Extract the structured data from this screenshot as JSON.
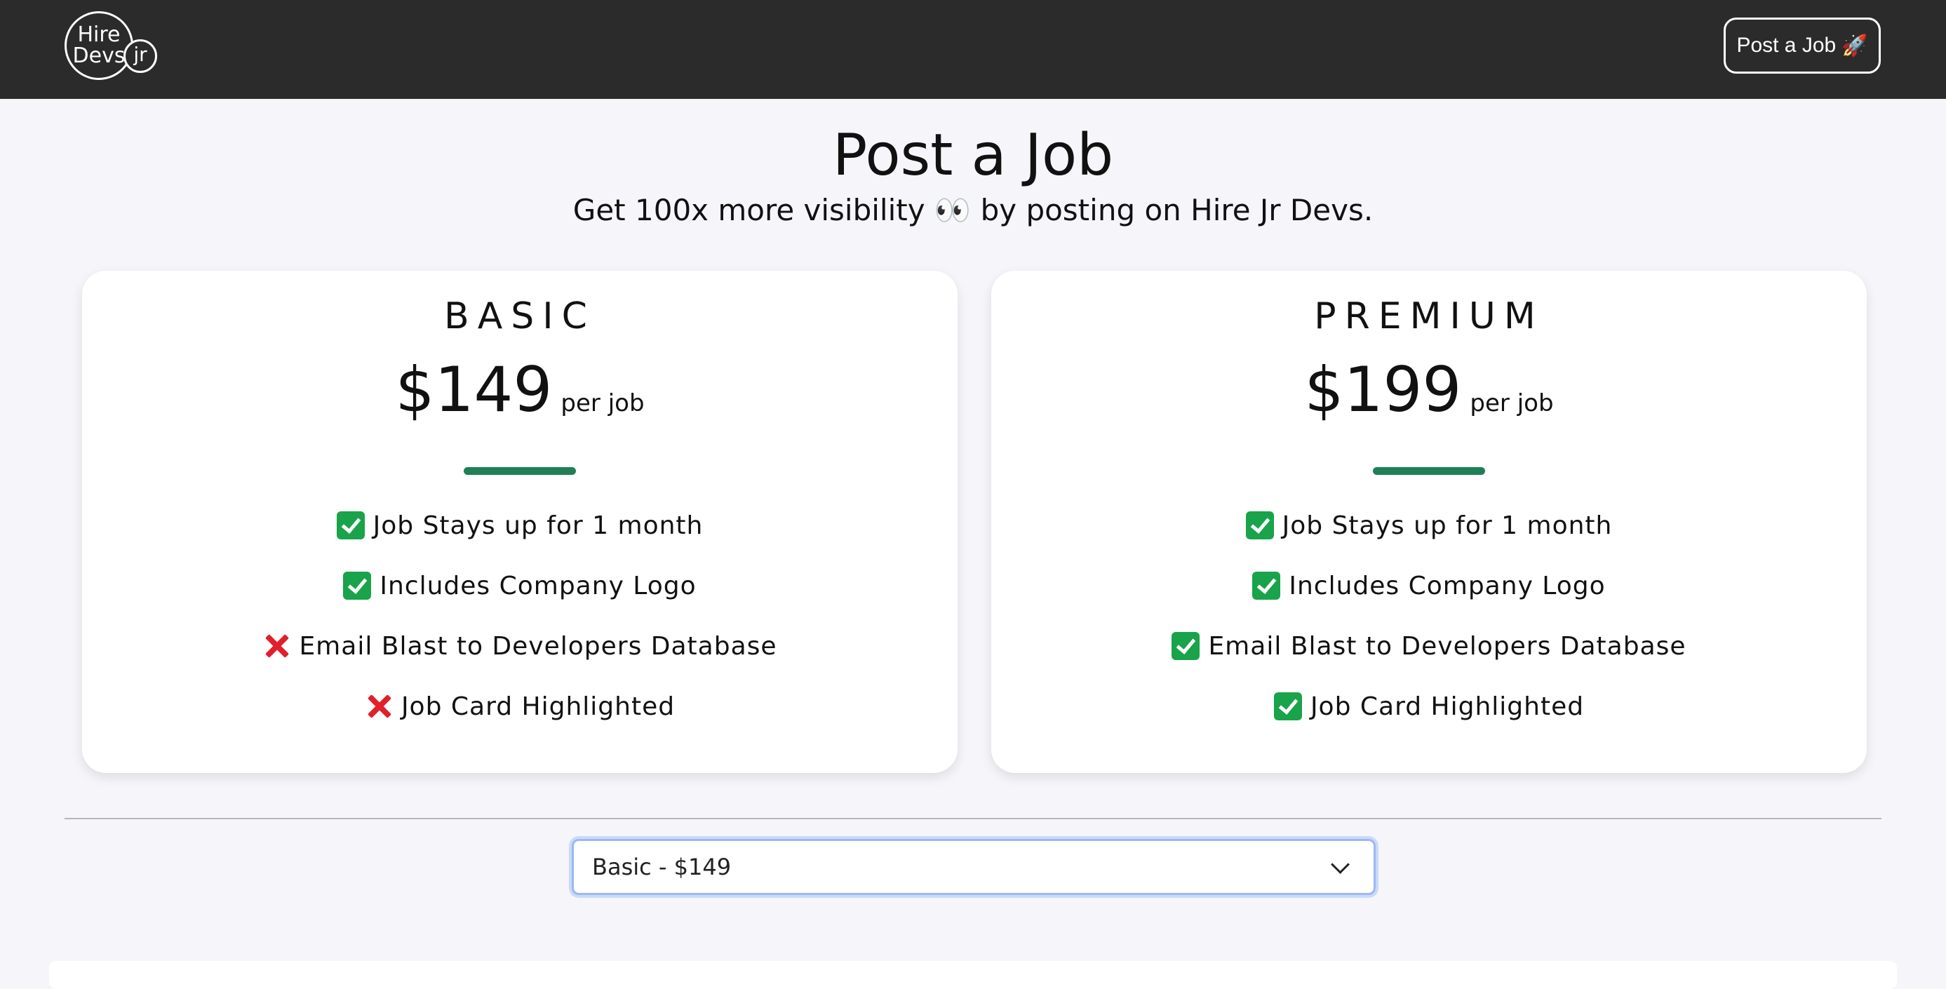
{
  "navbar": {
    "logo": {
      "line1": "Hire",
      "line2": "Devs",
      "badge": "jr"
    },
    "post_button": {
      "label": "Post a Job",
      "icon": "rocket-icon",
      "icon_glyph": "🚀"
    }
  },
  "hero": {
    "title": "Post a Job",
    "subtitle": "Get 100x more visibility 👀 by posting on Hire Jr Devs."
  },
  "plans": [
    {
      "name": "BASIC",
      "price": "$149",
      "per": "per job",
      "features": [
        {
          "text": "Job Stays up for 1 month",
          "included": true
        },
        {
          "text": "Includes Company Logo",
          "included": true
        },
        {
          "text": "Email Blast to Developers Database",
          "included": false
        },
        {
          "text": "Job Card Highlighted",
          "included": false
        }
      ]
    },
    {
      "name": "PREMIUM",
      "price": "$199",
      "per": "per job",
      "features": [
        {
          "text": "Job Stays up for 1 month",
          "included": true
        },
        {
          "text": "Includes Company Logo",
          "included": true
        },
        {
          "text": "Email Blast to Developers Database",
          "included": true
        },
        {
          "text": "Job Card Highlighted",
          "included": true
        }
      ]
    }
  ],
  "plan_select": {
    "value": "Basic - $149"
  },
  "colors": {
    "navbar": "#2b2b2b",
    "accent_bar": "#1f7f55",
    "check": "#19a34a",
    "cross": "#e0202b",
    "background": "#f6f5fa"
  }
}
